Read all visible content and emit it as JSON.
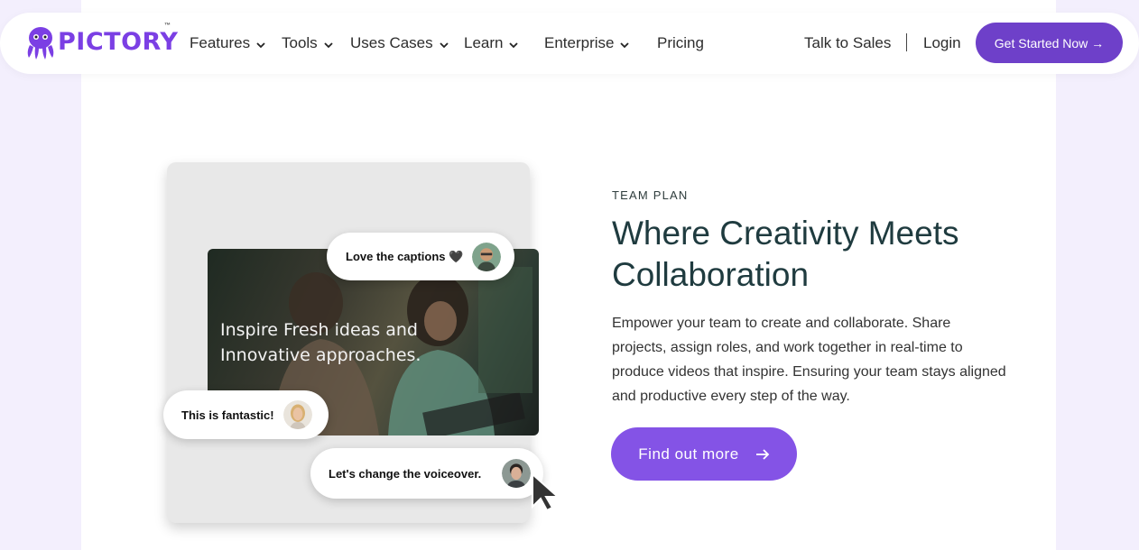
{
  "brand": {
    "name": "PICTORY",
    "tm": "™",
    "accent": "#7b3fe4"
  },
  "nav": {
    "items": [
      {
        "label": "Features",
        "dropdown": true
      },
      {
        "label": "Tools",
        "dropdown": true
      },
      {
        "label": "Uses Cases",
        "dropdown": true
      },
      {
        "label": "Learn",
        "dropdown": true
      },
      {
        "label": "Enterprise",
        "dropdown": true
      },
      {
        "label": "Pricing",
        "dropdown": false
      }
    ],
    "talk_to_sales": "Talk to Sales",
    "login": "Login",
    "cta": "Get Started Now →"
  },
  "hero_visual": {
    "video_overlay_line1": "Inspire Fresh ideas and",
    "video_overlay_line2": "Innovative approaches.",
    "comments": [
      {
        "text": "Love the captions 🖤"
      },
      {
        "text": "This is fantastic!"
      },
      {
        "text": "Let's change the voiceover."
      }
    ]
  },
  "hero_text": {
    "eyebrow": "TEAM PLAN",
    "headline": "Where Creativity Meets Collaboration",
    "body": "Empower your team to create and collaborate. Share projects, assign roles, and work together in real-time to produce videos that inspire. Ensuring your team stays aligned and productive every step of the way.",
    "cta": "Find out more",
    "cta_icon": "arrow-right-icon"
  },
  "colors": {
    "primary": "#6e40c9",
    "button": "#8453e6",
    "heading": "#1f3b3f",
    "background": "#f3effd"
  }
}
